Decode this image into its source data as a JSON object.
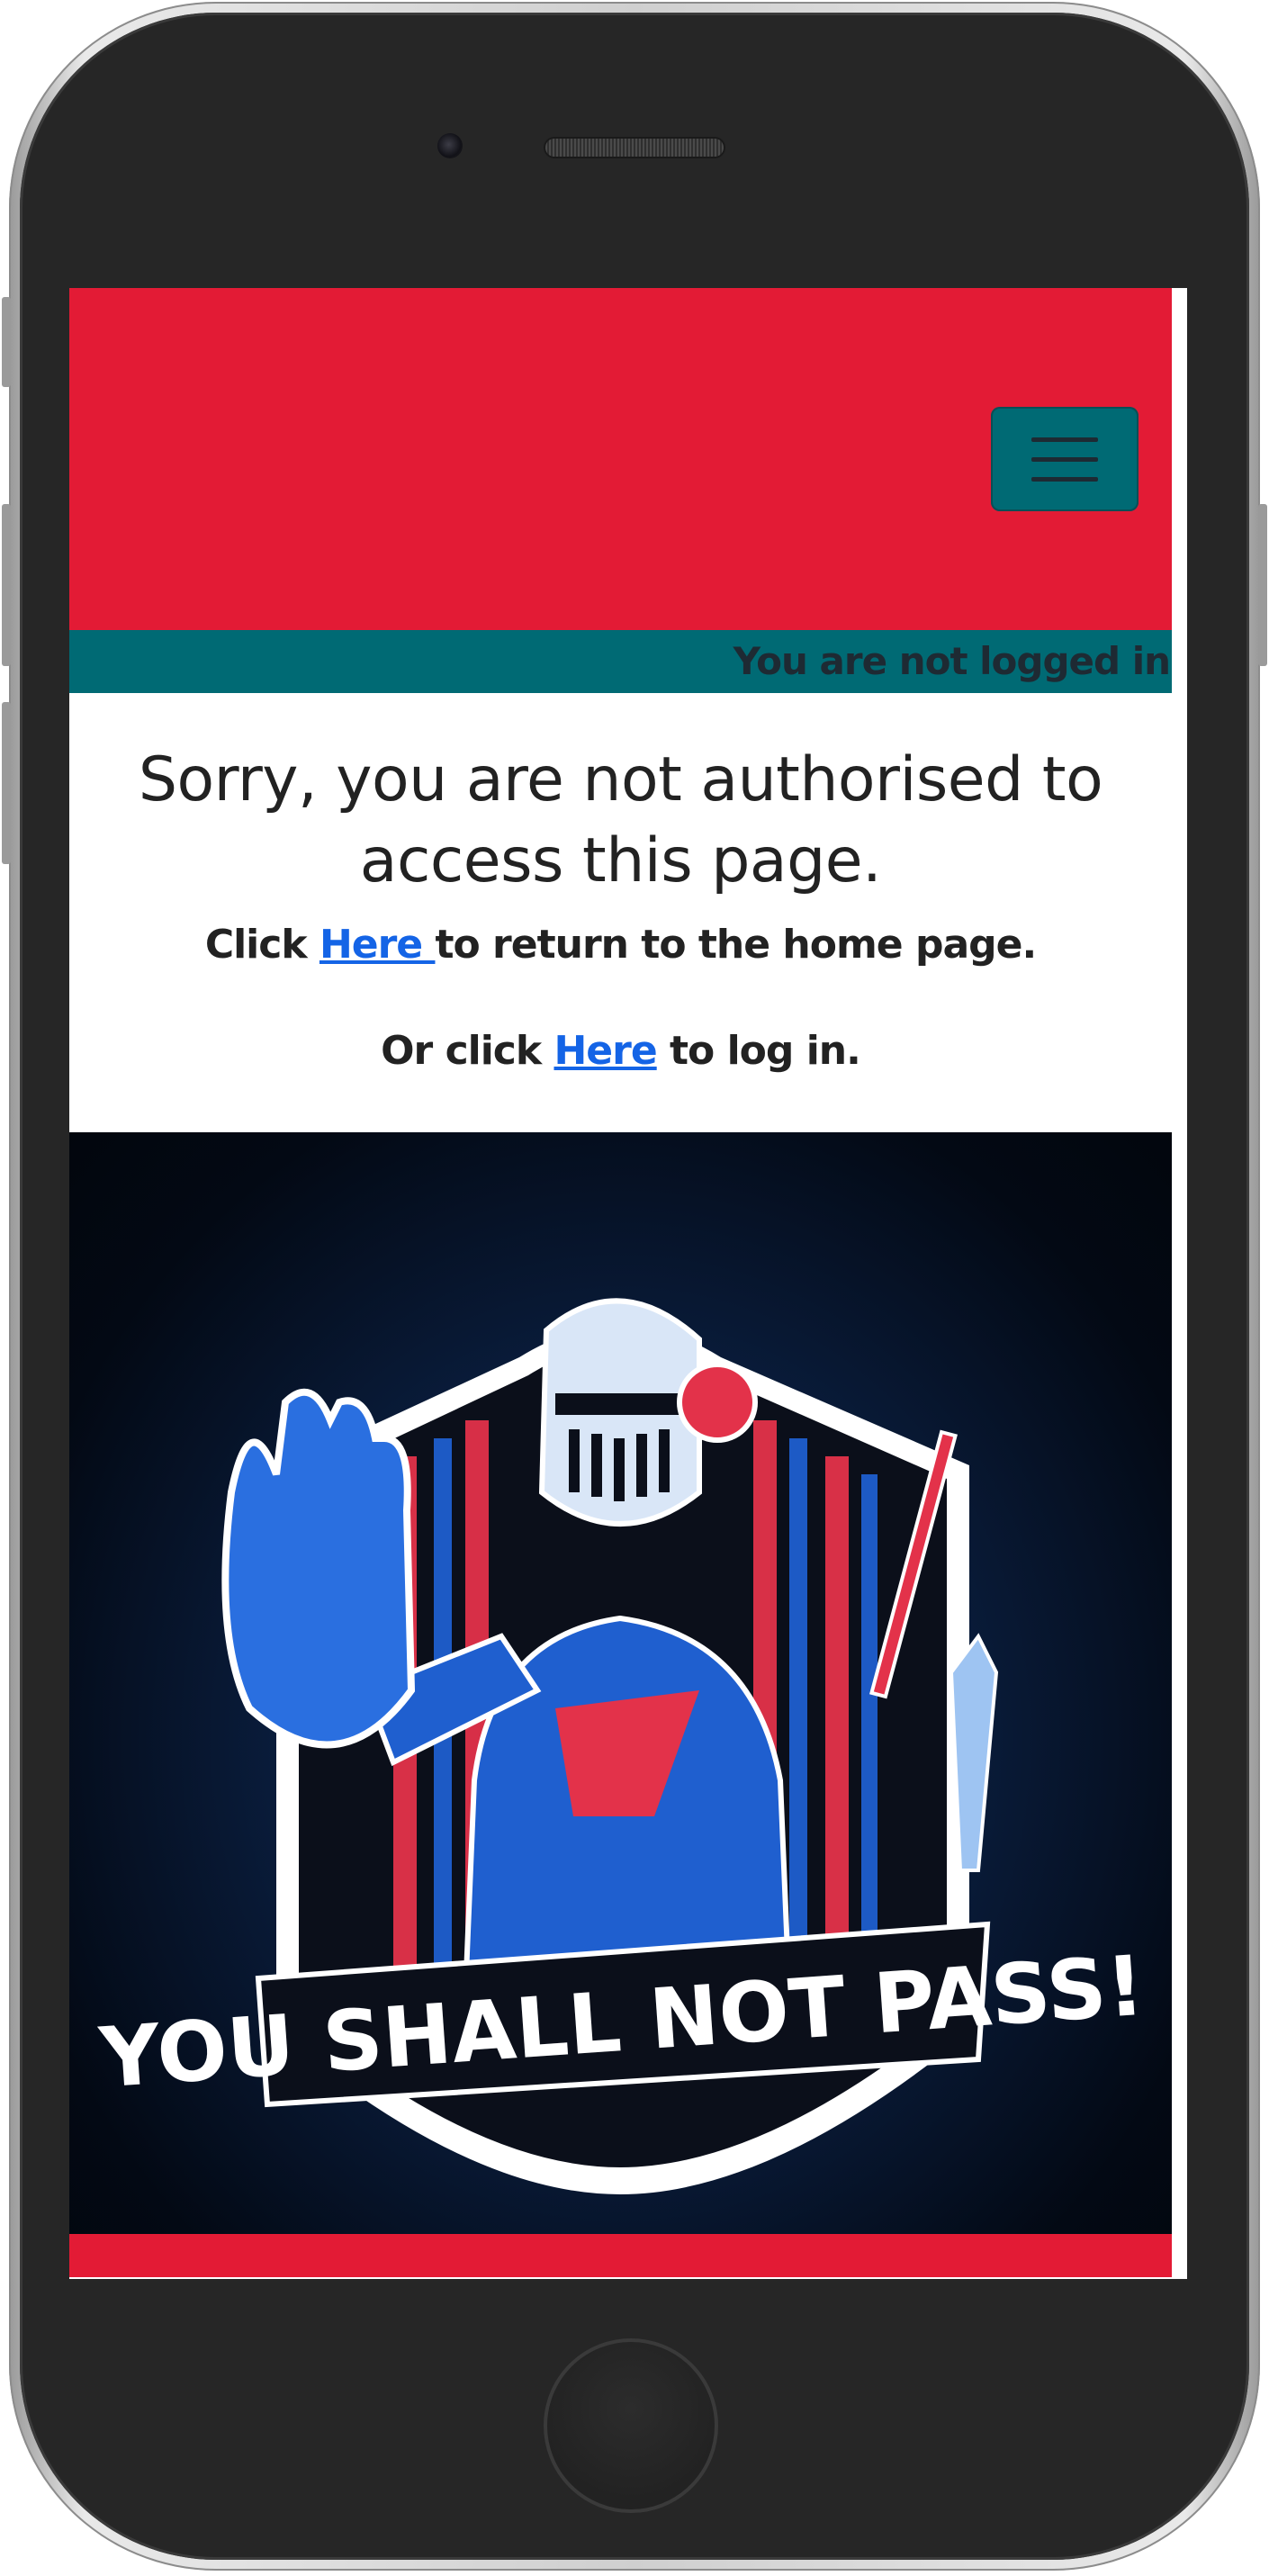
{
  "colors": {
    "navbar": "#e31b35",
    "status_bar": "#006a74",
    "link": "#1464e6",
    "text": "#222222"
  },
  "header": {
    "menu_toggle_icon": "hamburger-icon"
  },
  "status": {
    "login_text": "You are not logged in"
  },
  "main": {
    "heading": "Sorry, you are not authorised to access this page.",
    "line1_before": "Click ",
    "line1_link": "Here ",
    "line1_after": "to return to the home page.",
    "line2_before": "Or click ",
    "line2_link": "Here",
    "line2_after": " to log in."
  },
  "hero": {
    "banner_text": "YOU SHALL NOT PASS!"
  }
}
